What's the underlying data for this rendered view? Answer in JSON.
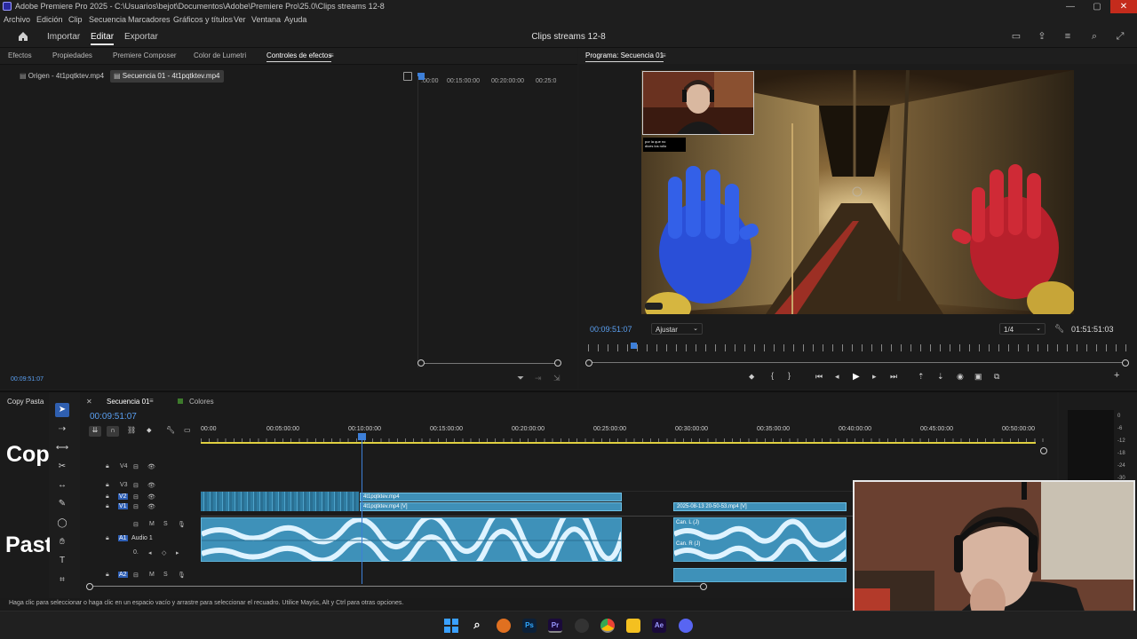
{
  "titlebar": {
    "title": "Adobe Premiere Pro 2025 - C:\\Usuarios\\bejot\\Documentos\\Adobe\\Premiere Pro\\25.0\\Clips streams 12-8",
    "minimize": "—",
    "maximize": "▢",
    "close": "✕"
  },
  "menu": [
    "Archivo",
    "Edición",
    "Clip",
    "Secuencia",
    "Marcadores",
    "Gráficos y títulos",
    "Ver",
    "Ventana",
    "Ayuda"
  ],
  "header": {
    "workspaces": [
      "Importar",
      "Editar",
      "Exportar"
    ],
    "active_workspace": "Editar",
    "project_title": "Clips streams 12-8"
  },
  "left_panel": {
    "tabs": [
      "Efectos",
      "Propiedades",
      "Premiere Composer",
      "Color de Lumetri",
      "Controles de efectos"
    ],
    "active_tab": "Controles de efectos",
    "source_label": "Origen - 4t1pqtktev.mp4",
    "sequence_label": "Secuencia 01 - 4t1pqtktev.mp4",
    "ruler": [
      ":00:00",
      "00:15:00:00",
      "00:20:00:00",
      "00:25:0"
    ],
    "timecode": "00:09:51:07"
  },
  "program_monitor": {
    "title": "Programa: Secuencia 01",
    "timecode": "00:09:51:07",
    "fit_label": "Ajustar",
    "resolution": "1/4",
    "duration": "01:51:51:03",
    "overlay_text_line1": "por la que no",
    "overlay_text_line2": "dices los rollo"
  },
  "timeline": {
    "panel_label": "Copy Pasta",
    "sequence_tab": "Secuencia 01",
    "colors_tab": "Colores",
    "timecode": "00:09:51:07",
    "ruler": [
      "00:00",
      "00:05:00:00",
      "00:10:00:00",
      "00:15:00:00",
      "00:20:00:00",
      "00:25:00:00",
      "00:30:00:00",
      "00:35:00:00",
      "00:40:00:00",
      "00:45:00:00",
      "00:50:00:00"
    ],
    "playhead_fraction": 0.197,
    "tracks": {
      "v4": "V4",
      "v3": "V3",
      "v2": "V2",
      "v1": "V1",
      "a1": "A1",
      "a1_name": "Audio 1",
      "a2": "A2",
      "a1_level": "0."
    },
    "clips": {
      "v2_clip": "4t1pqtktev.mp4",
      "v1_clip": "4t1pqtktev.mp4 [V]",
      "v1_clip2": "2025-08-13 20-50-53.mp4 [V]",
      "a_label_l": "Can. L (J)",
      "a_label_r": "Can. R (J)"
    },
    "big_text_1": "Cop",
    "big_text_2": "Past",
    "meter_labels": [
      "0",
      "-6",
      "-12",
      "-18",
      "-24",
      "-30"
    ]
  },
  "status_bar": "Haga clic para seleccionar o haga clic en un espacio vacío y arrastre para seleccionar el recuadro. Utilice Mayús, Alt y Ctrl para otras opciones.",
  "taskbar": {
    "ps": "Ps",
    "pr": "Pr",
    "ae": "Ae"
  }
}
